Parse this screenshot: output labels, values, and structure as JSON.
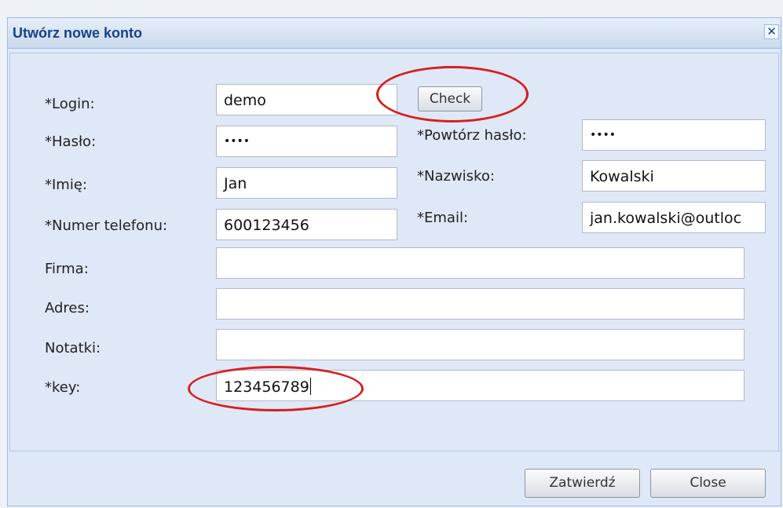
{
  "dialog": {
    "title": "Utwórz nowe konto",
    "close_glyph": "✕"
  },
  "form": {
    "login_label": "*Login:",
    "login_value": "demo",
    "check_button": "Check",
    "haslo_label": "*Hasło:",
    "haslo_value": "••••",
    "powtorz_label": "*Powtórz hasło:",
    "powtorz_value": "••••",
    "imie_label": "*Imię:",
    "imie_value": "Jan",
    "nazwisko_label": "*Nazwisko:",
    "nazwisko_value": "Kowalski",
    "telefon_label": "*Numer telefonu:",
    "telefon_value": "600123456",
    "email_label": "*Email:",
    "email_value": "jan.kowalski@outloc",
    "firma_label": "Firma:",
    "firma_value": "",
    "adres_label": "Adres:",
    "adres_value": "",
    "notatki_label": "Notatki:",
    "notatki_value": "",
    "key_label": "*key:",
    "key_value": "123456789"
  },
  "buttons": {
    "confirm": "Zatwierdź",
    "close": "Close"
  },
  "colors": {
    "title_text": "#15428b",
    "highlight_ring": "#d61f1f",
    "panel_bg": "#dfe8f6"
  }
}
